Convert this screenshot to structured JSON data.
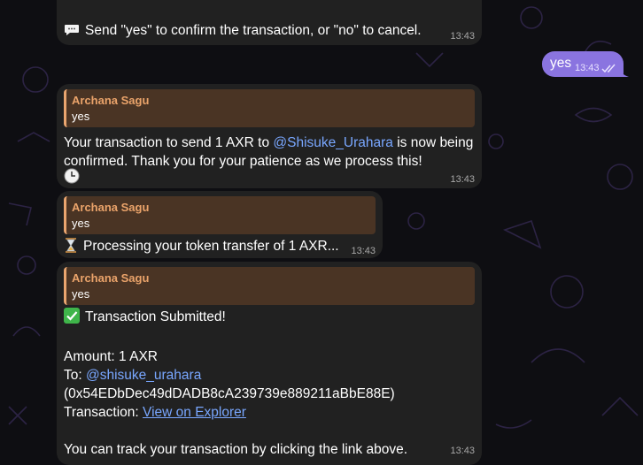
{
  "messages": {
    "m1": {
      "icon": "speech-bubble-icon",
      "text": "Send \"yes\" to confirm the transaction, or \"no\" to cancel.",
      "time": "13:43"
    },
    "out": {
      "text": "yes",
      "time": "13:43",
      "status_icon": "double-check-icon"
    },
    "m2": {
      "reply_name": "Archana Sagu",
      "reply_text": "yes",
      "text_before": "Your transaction to send 1 AXR to ",
      "mention": "@Shisuke_Urahara",
      "text_after": " is now being confirmed. Thank you for your patience as we process this!",
      "icon": "clock-icon",
      "time": "13:43"
    },
    "m3": {
      "reply_name": "Archana Sagu",
      "reply_text": "yes",
      "icon": "hourglass-icon",
      "text": "Processing your token transfer of 1 AXR...",
      "time": "13:43"
    },
    "m4": {
      "reply_name": "Archana Sagu",
      "reply_text": "yes",
      "icon": "check-mark-icon",
      "headline": "Transaction Submitted!",
      "amount": "Amount: 1 AXR",
      "to_label": "To: ",
      "to_mention": "@shisuke_urahara",
      "address": "(0x54EDbDec49dDADB8cA239739e889211aBbE88E)",
      "tx_label": "Transaction: ",
      "tx_link": "View on Explorer",
      "track": "You can track your transaction by clicking the link above.",
      "time": "13:43"
    }
  },
  "colors": {
    "background": "#0e0e12",
    "incoming_bubble": "#212121",
    "outgoing_bubble": "#8a74e0",
    "reply_accent": "#eaa36a",
    "link": "#79a7ff"
  }
}
